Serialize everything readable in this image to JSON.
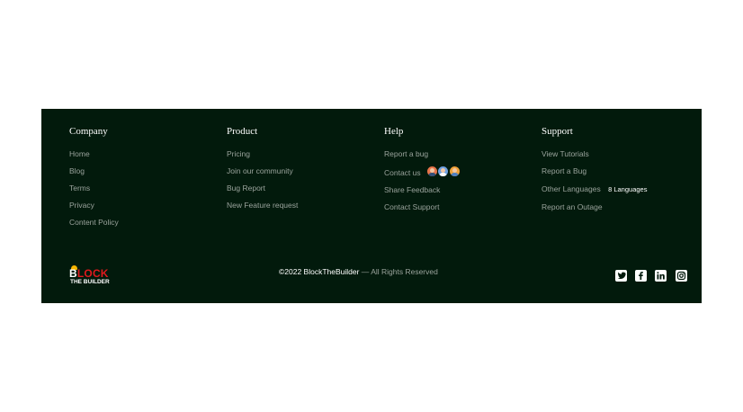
{
  "footer": {
    "columns": [
      {
        "title": "Company",
        "links": [
          "Home",
          "Blog",
          "Terms",
          "Privacy",
          "Content Policy"
        ]
      },
      {
        "title": "Product",
        "links": [
          "Pricing",
          "Join our community",
          "Bug Report",
          "New Feature request"
        ]
      },
      {
        "title": "Help",
        "links": [
          "Report a bug",
          "Contact us",
          "Share Feedback",
          "Contact Support"
        ]
      },
      {
        "title": "Support",
        "links": [
          "View Tutorials",
          "Report a Bug",
          "Other Languages",
          "Report an Outage"
        ]
      }
    ],
    "languages_badge": "8 Languages",
    "logo": {
      "line1_letter": "B",
      "line1_rest": "LOCK",
      "line2": "THE BUILDER"
    },
    "copyright": {
      "main": "©2022 BlockTheBuilder",
      "rest": " — All Rights Reserved"
    },
    "social_icons": [
      "twitter-icon",
      "facebook-icon",
      "linkedin-icon",
      "instagram-icon"
    ],
    "colors": {
      "background": "#021a0c",
      "link": "#9aa39c",
      "heading": "#ffffff",
      "logo_red": "#e0191d",
      "logo_yellow": "#f7b500"
    }
  }
}
